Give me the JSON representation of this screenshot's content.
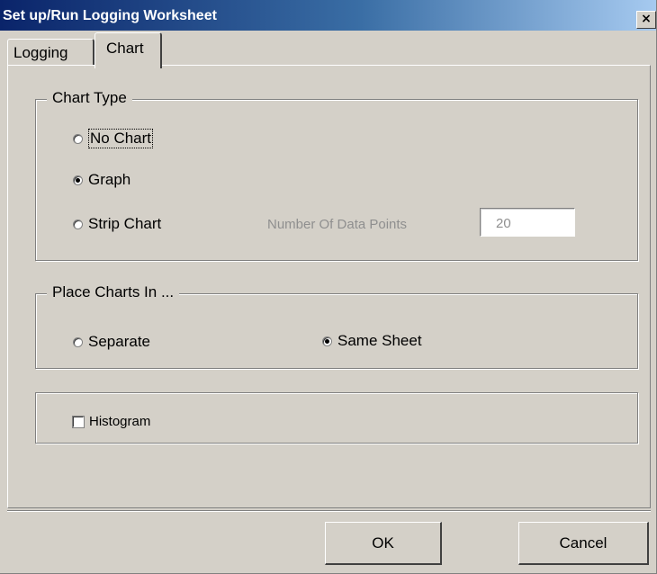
{
  "window": {
    "title": "Set up/Run Logging Worksheet",
    "close_label": "×"
  },
  "tabs": [
    {
      "label": "Logging",
      "active": false
    },
    {
      "label": "Chart",
      "active": true
    }
  ],
  "chart_type": {
    "legend": "Chart Type",
    "options": [
      {
        "label": "No Chart",
        "checked": false,
        "focused": true
      },
      {
        "label": "Graph",
        "checked": true,
        "focused": false
      },
      {
        "label": "Strip Chart",
        "checked": false,
        "focused": false
      }
    ],
    "data_points_label": "Number Of Data Points",
    "data_points_value": "20"
  },
  "place_charts": {
    "legend": "Place Charts In ...",
    "options": [
      {
        "label": "Separate",
        "checked": false
      },
      {
        "label": "Same Sheet",
        "checked": true
      }
    ]
  },
  "histogram": {
    "label": "Histogram",
    "checked": false
  },
  "buttons": {
    "ok": "OK",
    "cancel": "Cancel"
  },
  "colors": {
    "dialog_face": "#d4d0c8",
    "title_start": "#0a246a",
    "title_end": "#a6caf0",
    "disabled_text": "#8f8f8f"
  }
}
